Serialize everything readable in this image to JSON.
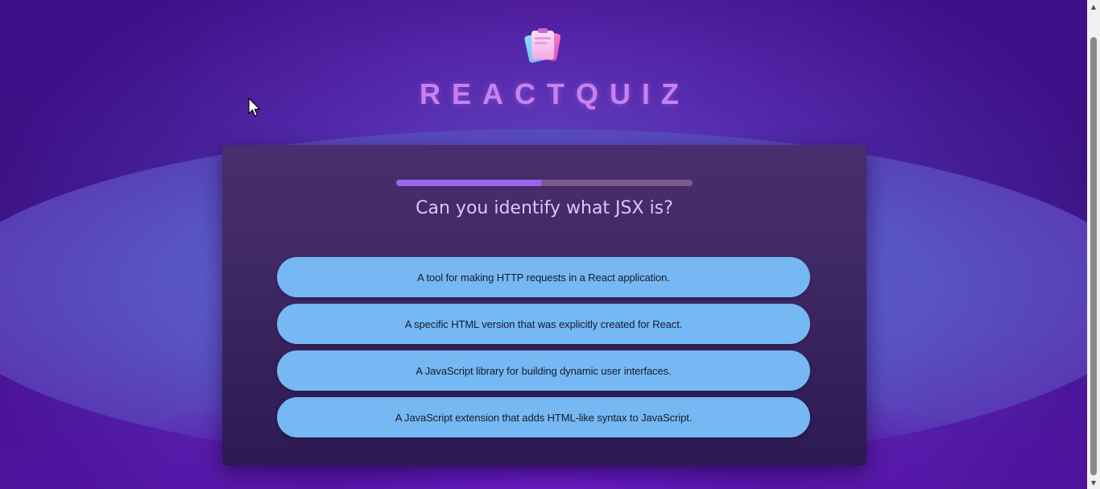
{
  "app": {
    "title": "REACTQUIZ",
    "logo_icon": "quiz-cards-logo-icon"
  },
  "progress": {
    "fraction": 0.49,
    "fill_color": "#9a66ee",
    "track_color": "#7a5d8e"
  },
  "question": {
    "text": "Can you identify what JSX is?"
  },
  "answers": [
    {
      "label": "A tool for making HTTP requests in a React application."
    },
    {
      "label": "A specific HTML version that was explicitly created for React."
    },
    {
      "label": "A JavaScript library for building dynamic user interfaces."
    },
    {
      "label": "A JavaScript extension that adds HTML-like syntax to JavaScript."
    }
  ],
  "colors": {
    "title": "#c980f0",
    "answer_background": "#75b8f3",
    "question_text": "#ddc7f4"
  },
  "icons": {
    "scroll_up": "▲",
    "scroll_down": "▼"
  }
}
